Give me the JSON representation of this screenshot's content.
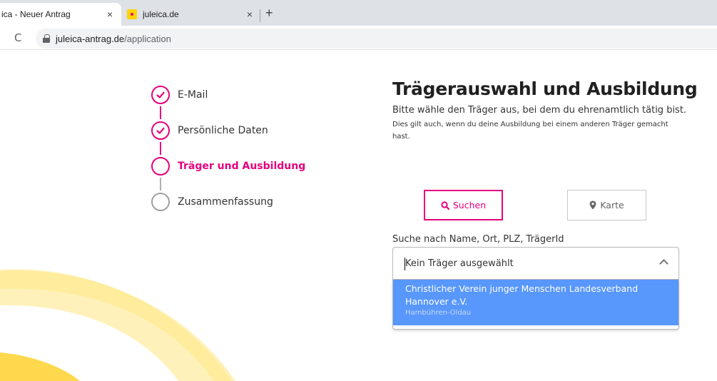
{
  "browser": {
    "tabs": [
      {
        "title": "ica - Neuer Antrag",
        "close": "×"
      },
      {
        "title": "juleica.de",
        "close": "×"
      }
    ],
    "new_tab": "+",
    "reload": "C",
    "url_host": "juleica-antrag.de",
    "url_path": "/application"
  },
  "steps": [
    {
      "label": "E-Mail",
      "status": "done"
    },
    {
      "label": "Persönliche Daten",
      "status": "done"
    },
    {
      "label": "Träger und Ausbildung",
      "status": "active"
    },
    {
      "label": "Zusammenfassung",
      "status": "todo"
    }
  ],
  "panel": {
    "title": "Trägerauswahl und Ausbildung",
    "lead": "Bitte wähle den Träger aus, bei dem du ehrenamtlich tätig bist.",
    "sub": "Dies gilt auch, wenn du deine Ausbildung bei einem anderen Träger gemacht hast.",
    "search_button": "Suchen",
    "map_button": "Karte",
    "field_label": "Suche nach Name, Ort, PLZ, TrägerId",
    "select_value": "Kein Träger ausgewählt",
    "option_name": "Christlicher Verein junger Menschen Landesverband Hannover e.V.",
    "option_place": "Hambühren-Oldau"
  },
  "colors": {
    "accent": "#e6007e",
    "option_bg": "#5897fb",
    "decor_yellow": "#ffd400"
  }
}
